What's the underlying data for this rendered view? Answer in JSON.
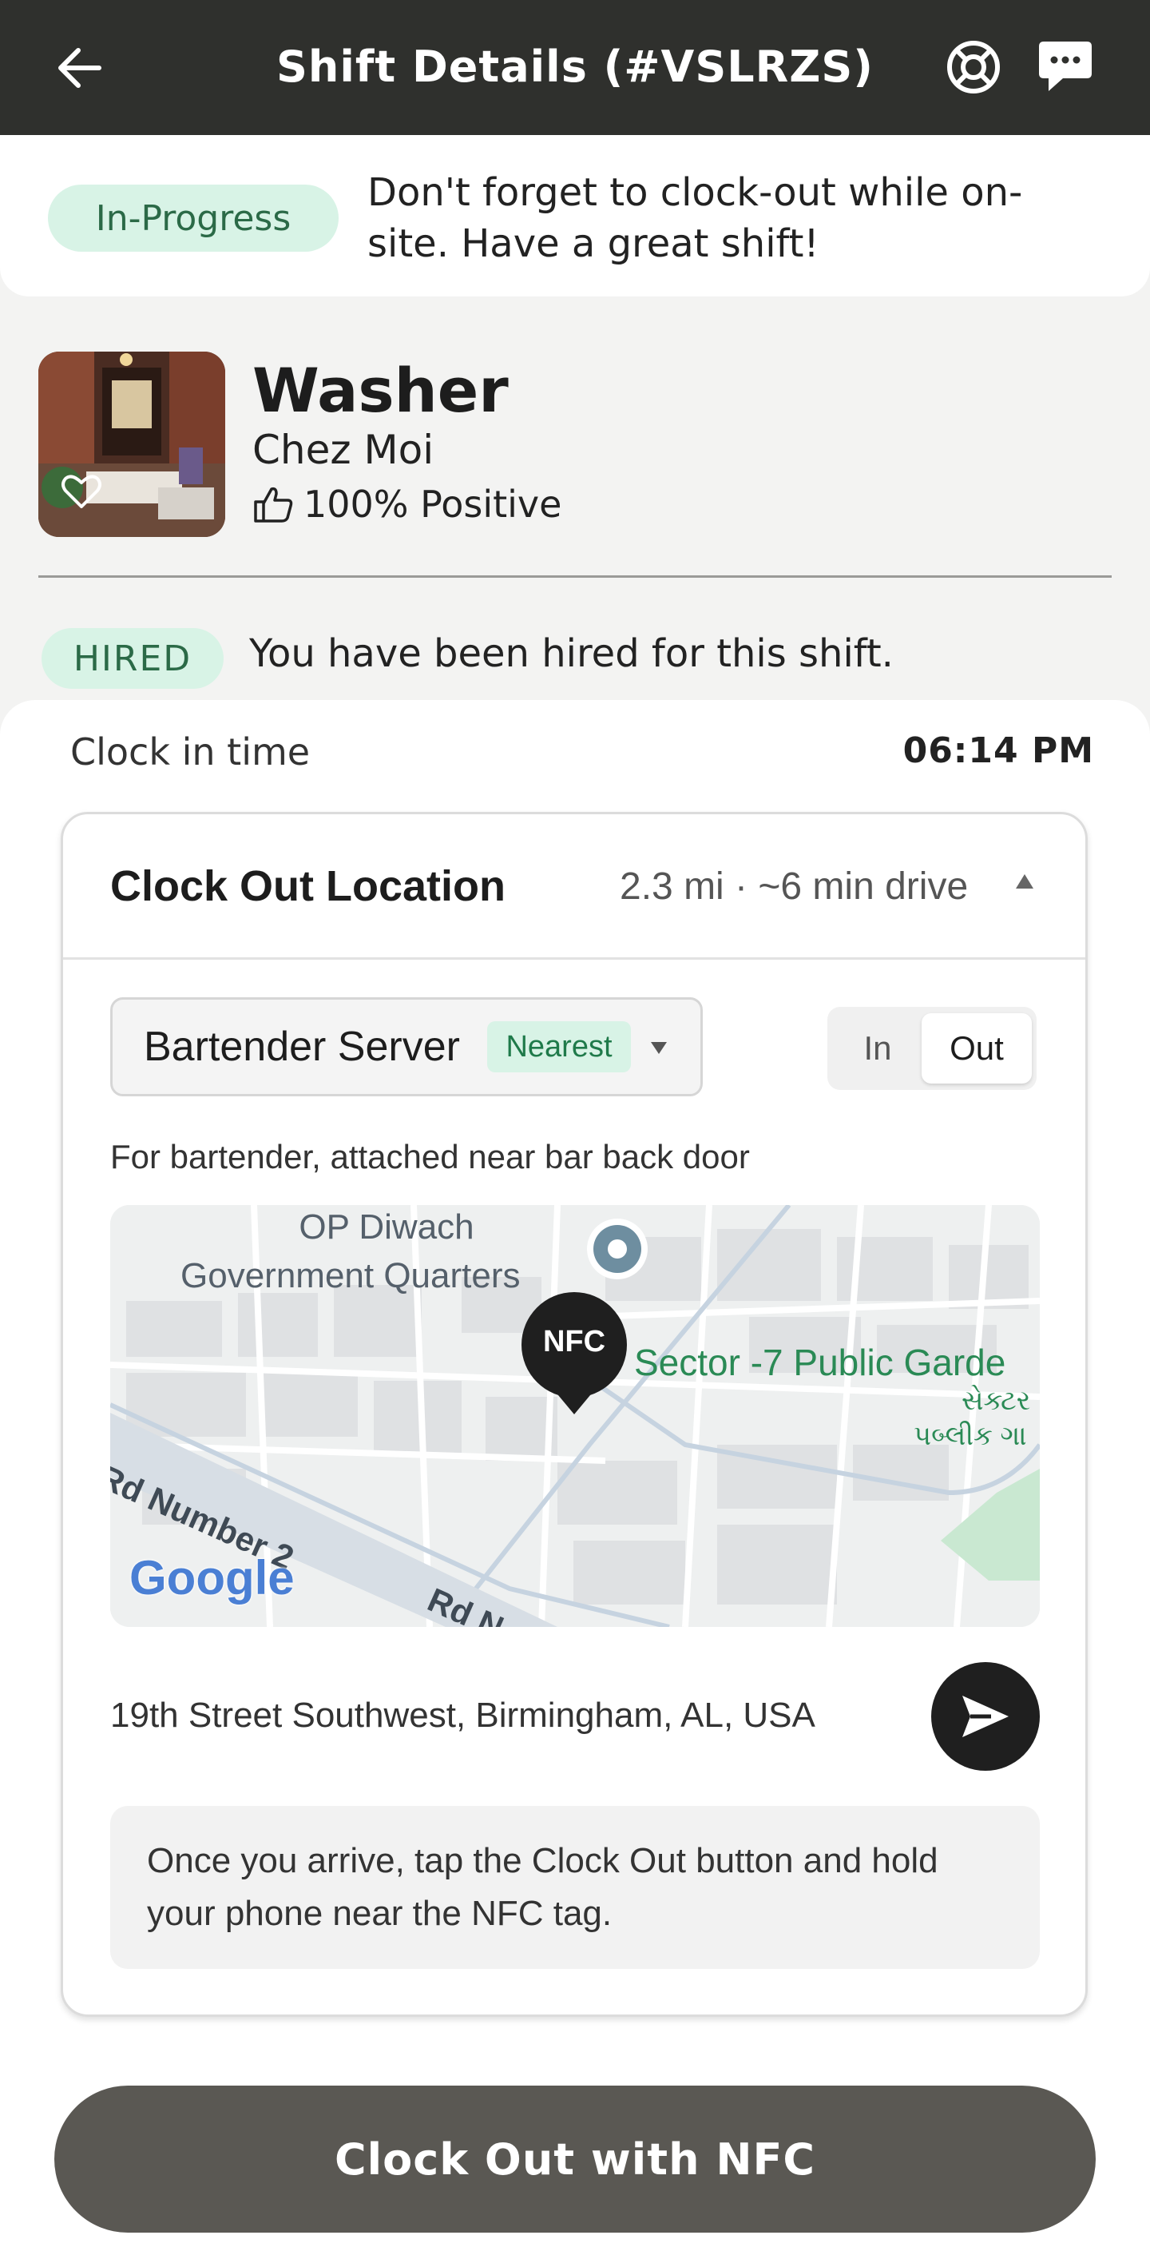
{
  "header": {
    "title": "Shift Details (#VSLRZS)",
    "back_icon": "arrow-left-icon",
    "help_icon": "lifebuoy-icon",
    "chat_icon": "chat-bubble-icon"
  },
  "status": {
    "badge": "In-Progress",
    "message": "Don't forget to clock-out while on-site. Have a great shift!"
  },
  "job": {
    "title": "Washer",
    "company": "Chez Moi",
    "rating": "100% Positive"
  },
  "hired": {
    "badge": "HIRED",
    "message": "You have been hired for this shift."
  },
  "clock_in": {
    "label": "Clock in time",
    "value": "06:14 PM"
  },
  "location": {
    "title": "Clock Out Location",
    "distance": "2.3 mi · ~6 min drive",
    "selected": "Bartender Server",
    "nearest_badge": "Nearest",
    "toggle": {
      "in": "In",
      "out": "Out",
      "active": "Out"
    },
    "description": "For bartender, attached near bar back door",
    "map": {
      "pin_label": "NFC",
      "label_1a": "OP Diwach",
      "label_1b": "Government Quarters",
      "label_2": "Sector -7 Public Garde",
      "label_3a": "સેક્ટર",
      "label_3b": "પબ્લીક ગા",
      "road_1": "Rd Number 2",
      "road_2": "Rd N",
      "brand": "Google"
    },
    "address": "19th Street Southwest, Birmingham, AL, USA",
    "note": "Once you arrive, tap the Clock Out button and hold your phone near the NFC tag."
  },
  "cta": "Clock Out with NFC",
  "colors": {
    "header_bg": "#2f302d",
    "badge_bg": "#d8f3e6",
    "badge_text": "#2b6a47",
    "cta_bg": "#5a5853"
  }
}
